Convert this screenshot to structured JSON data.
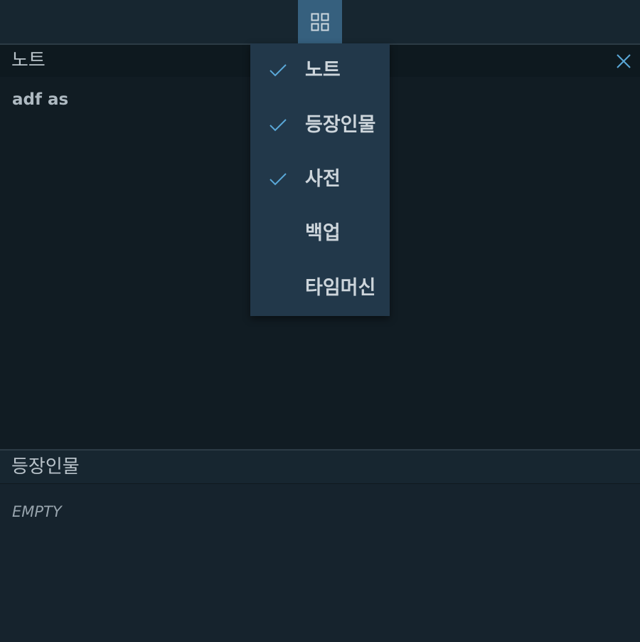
{
  "toolbar": {
    "panel_toggle_icon": "grid-icon",
    "accent_color": "#36607e"
  },
  "notes_panel": {
    "title": "노트",
    "close_icon": "close-icon",
    "items": [
      "adf as"
    ]
  },
  "characters_panel": {
    "title": "등장인물",
    "empty_text": "EMPTY"
  },
  "panel_menu": {
    "items": [
      {
        "label": "노트",
        "checked": true
      },
      {
        "label": "등장인물",
        "checked": true
      },
      {
        "label": "사전",
        "checked": true
      },
      {
        "label": "백업",
        "checked": false
      },
      {
        "label": "타임머신",
        "checked": false
      }
    ],
    "check_color": "#5aa8d8"
  }
}
